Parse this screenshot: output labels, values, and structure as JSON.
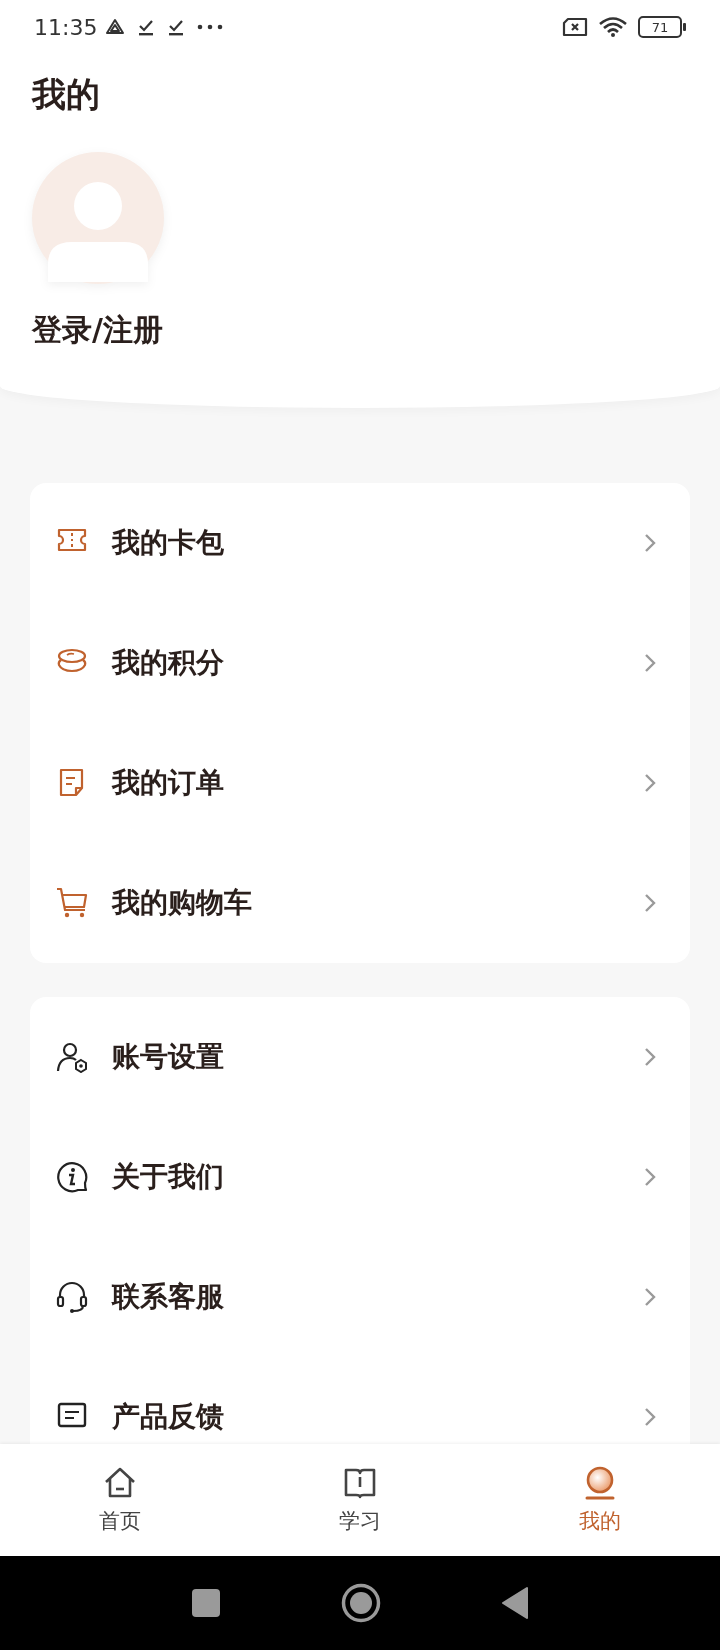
{
  "status_bar": {
    "time": "11:35",
    "battery": "71"
  },
  "header": {
    "title": "我的",
    "login": "登录/注册"
  },
  "menu_groups": [
    {
      "items": [
        {
          "kind": "ticket",
          "label": "我的卡包"
        },
        {
          "kind": "coins",
          "label": "我的积分"
        },
        {
          "kind": "order",
          "label": "我的订单"
        },
        {
          "kind": "cart",
          "label": "我的购物车"
        }
      ]
    },
    {
      "items": [
        {
          "kind": "account",
          "label": "账号设置"
        },
        {
          "kind": "info",
          "label": "关于我们"
        },
        {
          "kind": "headset",
          "label": "联系客服"
        },
        {
          "kind": "feedback",
          "label": "产品反馈"
        }
      ]
    }
  ],
  "tab_bar": [
    {
      "kind": "home",
      "label": "首页",
      "selected": false
    },
    {
      "kind": "study",
      "label": "学习",
      "selected": false
    },
    {
      "kind": "mine",
      "label": "我的",
      "selected": true
    }
  ]
}
